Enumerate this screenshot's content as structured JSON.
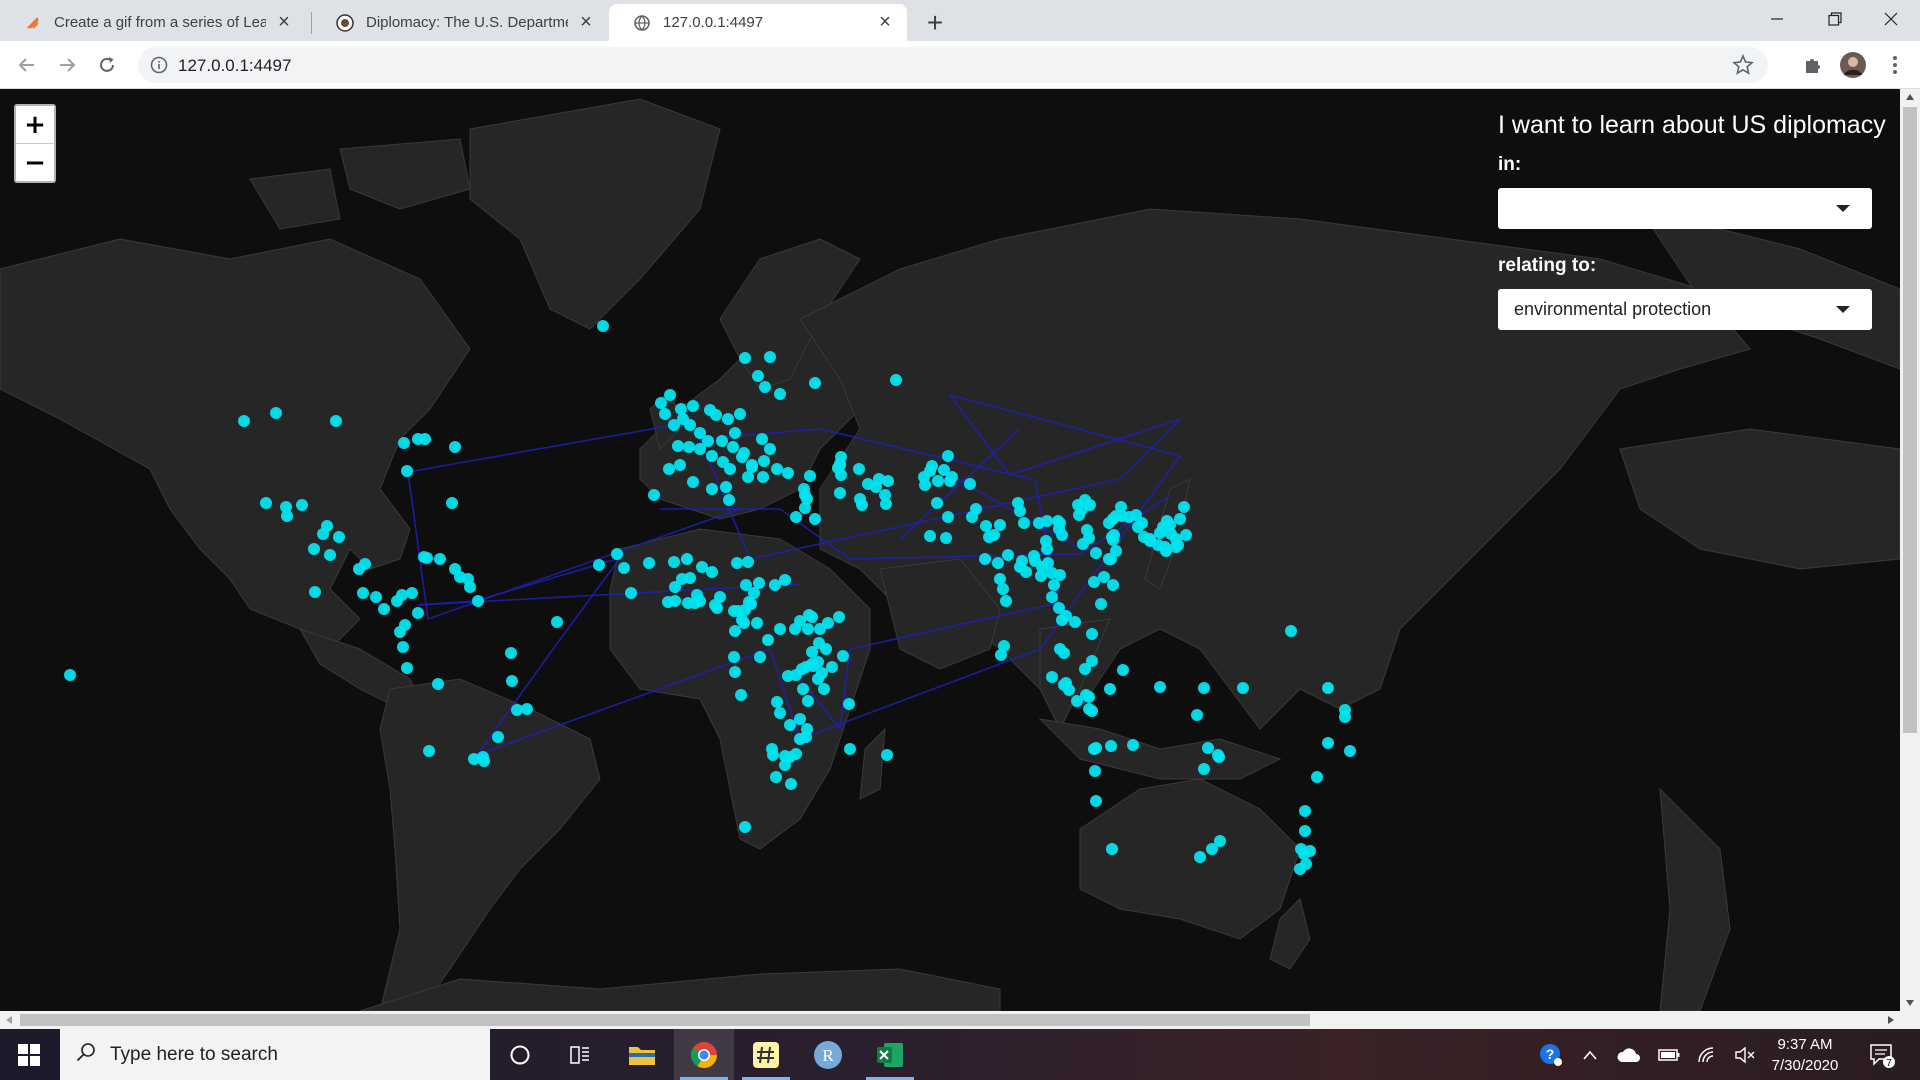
{
  "browser": {
    "tabs": [
      {
        "title": "Create a gif from a series of Leafl",
        "icon": "leaflet-favicon"
      },
      {
        "title": "Diplomacy: The U.S. Department",
        "icon": "state-dept-seal-favicon"
      },
      {
        "title": "127.0.0.1:4497",
        "icon": "globe-icon",
        "active": true
      }
    ],
    "url": "127.0.0.1:4497"
  },
  "map": {
    "zoom_in_label": "+",
    "zoom_out_label": "−",
    "marker_color": "#00e5f0",
    "line_color": "#1f1fb8"
  },
  "panel": {
    "title": "I want to learn about US diplomacy",
    "in_label": "in:",
    "in_value": "",
    "relating_label": "relating to:",
    "relating_value": "environmental protection"
  },
  "taskbar": {
    "search_placeholder": "Type here to search",
    "time": "9:37 AM",
    "date": "7/30/2020",
    "notification_count": "7"
  }
}
